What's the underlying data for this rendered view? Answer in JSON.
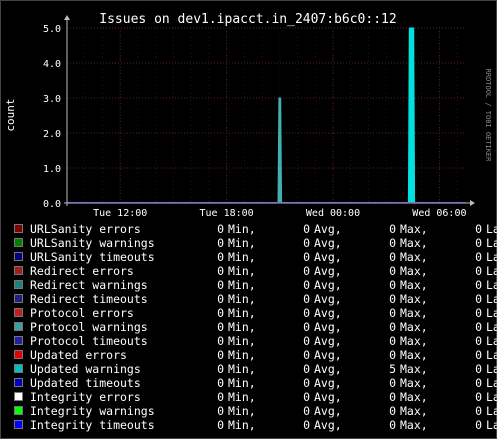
{
  "chart_data": {
    "type": "line",
    "title": "Issues on dev1.ipacct.in_2407:b6c0::12",
    "ylabel": "count",
    "watermark": "RRDTOOL / TOBI OETIKER",
    "ylim": [
      0,
      5
    ],
    "yticks": [
      "0.0",
      "1.0",
      "2.0",
      "3.0",
      "4.0",
      "5.0"
    ],
    "xlim": [
      "Tue 09:00",
      "Wed 07:30"
    ],
    "xticks": [
      {
        "label": "Tue 12:00",
        "t": 3
      },
      {
        "label": "Tue 18:00",
        "t": 9
      },
      {
        "label": "Wed 00:00",
        "t": 15
      },
      {
        "label": "Wed 06:00",
        "t": 21
      }
    ],
    "t_span": 22.5,
    "grid": true,
    "series": [
      {
        "name": "Protocol warnings",
        "color": "#40b0b0",
        "points": [
          {
            "t": 11.9,
            "v": 0
          },
          {
            "t": 11.95,
            "v": 3
          },
          {
            "t": 12.05,
            "v": 3
          },
          {
            "t": 12.1,
            "v": 0
          }
        ]
      },
      {
        "name": "Updated warnings",
        "color": "#00e0e0",
        "points": [
          {
            "t": 19.25,
            "v": 0
          },
          {
            "t": 19.3,
            "v": 5
          },
          {
            "t": 19.55,
            "v": 5
          },
          {
            "t": 19.6,
            "v": 0
          }
        ]
      }
    ]
  },
  "legend": {
    "rows": [
      {
        "name": "URLSanity errors",
        "color": "#800000",
        "min": "0",
        "avg": "0",
        "max": "0",
        "last": "0"
      },
      {
        "name": "URLSanity warnings",
        "color": "#008000",
        "min": "0",
        "avg": "0",
        "max": "0",
        "last": "0"
      },
      {
        "name": "URLSanity timeouts",
        "color": "#000080",
        "min": "0",
        "avg": "0",
        "max": "0",
        "last": "0"
      },
      {
        "name": "Redirect errors",
        "color": "#a02020",
        "min": "0",
        "avg": "0",
        "max": "0",
        "last": "0"
      },
      {
        "name": "Redirect warnings",
        "color": "#208080",
        "min": "0",
        "avg": "0",
        "max": "0",
        "last": "0"
      },
      {
        "name": "Redirect timeouts",
        "color": "#202080",
        "min": "0",
        "avg": "0",
        "max": "0",
        "last": "0"
      },
      {
        "name": "Protocol errors",
        "color": "#c02020",
        "min": "0",
        "avg": "0",
        "max": "0",
        "last": "0"
      },
      {
        "name": "Protocol warnings",
        "color": "#40a0a0",
        "min": "0",
        "avg": "0",
        "max": "0",
        "last": "0"
      },
      {
        "name": "Protocol timeouts",
        "color": "#2020a0",
        "min": "0",
        "avg": "0",
        "max": "0",
        "last": "0"
      },
      {
        "name": "Updated errors",
        "color": "#e00000",
        "min": "0",
        "avg": "0",
        "max": "0",
        "last": "0"
      },
      {
        "name": "Updated warnings",
        "color": "#00c0c0",
        "min": "0",
        "avg": "0",
        "max": "5",
        "last": "0"
      },
      {
        "name": "Updated timeouts",
        "color": "#0000c0",
        "min": "0",
        "avg": "0",
        "max": "0",
        "last": "0"
      },
      {
        "name": "Integrity errors",
        "color": "#ffffff",
        "min": "0",
        "avg": "0",
        "max": "0",
        "last": "0"
      },
      {
        "name": "Integrity warnings",
        "color": "#00ff00",
        "min": "0",
        "avg": "0",
        "max": "0",
        "last": "0"
      },
      {
        "name": "Integrity timeouts",
        "color": "#0000ff",
        "min": "0",
        "avg": "0",
        "max": "0",
        "last": "0"
      }
    ],
    "min_label": "Min,",
    "avg_label": "Avg,",
    "max_label": "Max,",
    "last_label": "Last"
  }
}
